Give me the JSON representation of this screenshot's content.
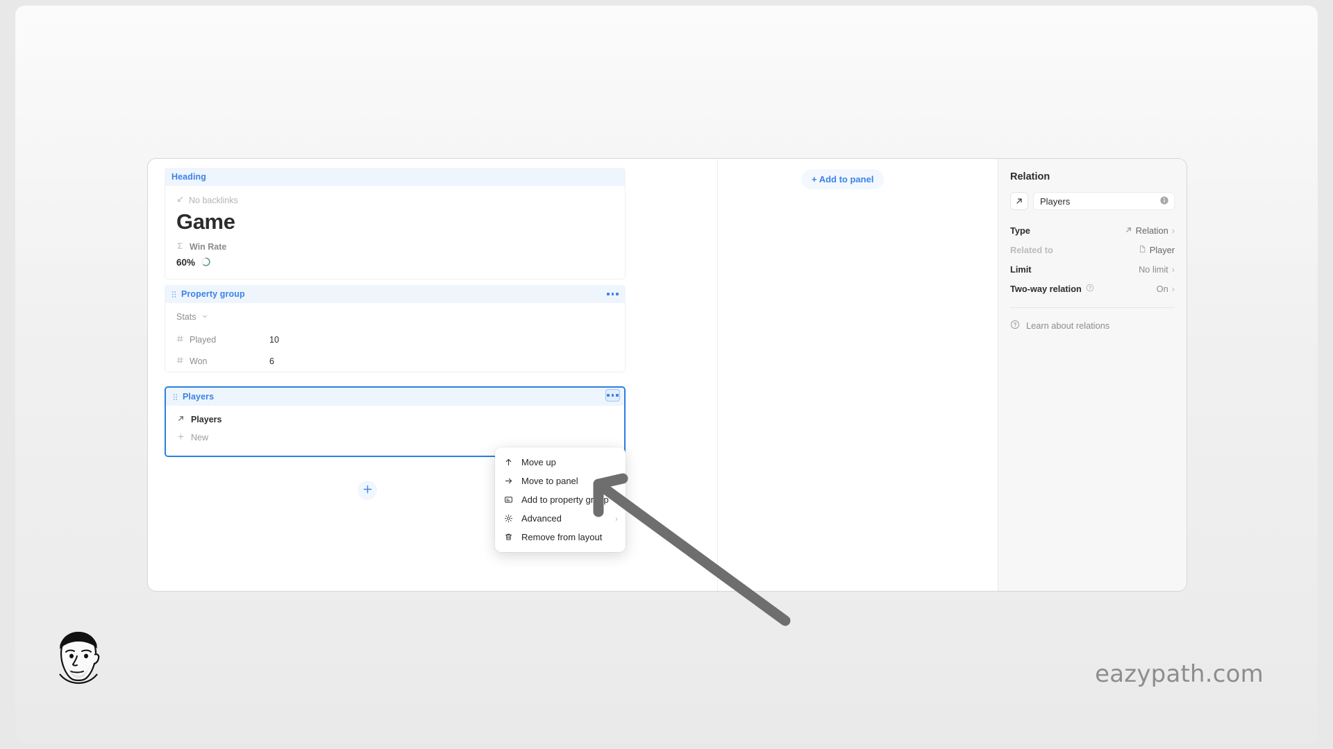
{
  "blocks": {
    "heading": {
      "label": "Heading",
      "backlinks": "No backlinks",
      "backlinks_icon": "arrow-down-left-icon",
      "title": "Game",
      "winrate_label": "Win Rate",
      "winrate_icon": "sigma-icon",
      "winrate_value": "60%",
      "winrate_percent": 60,
      "winrate_color": "#5e9e85"
    },
    "property_group": {
      "label": "Property group",
      "drag_icon": "drag-handle-icon",
      "more_icon": "ellipsis-icon",
      "section": "Stats",
      "section_chevron": "chevron-down-icon",
      "rows": [
        {
          "icon": "hash-icon",
          "key": "Played",
          "value": "10"
        },
        {
          "icon": "hash-icon",
          "key": "Won",
          "value": "6"
        }
      ]
    },
    "players": {
      "label": "Players",
      "drag_icon": "drag-handle-icon",
      "more_icon": "ellipsis-icon",
      "relation_icon": "arrow-up-right-icon",
      "relation_name": "Players",
      "new_icon": "plus-icon",
      "new_label": "New",
      "selected_color": "#2a7ee0"
    },
    "add_block_button": {
      "icon": "plus-icon",
      "label": "+"
    }
  },
  "panel": {
    "add_to_panel_label": "+ Add to panel",
    "accent": "#3b82e8"
  },
  "context_menu": {
    "items": [
      {
        "icon": "arrow-up-icon",
        "label": "Move up",
        "submenu": false
      },
      {
        "icon": "arrow-right-icon",
        "label": "Move to panel",
        "submenu": false
      },
      {
        "icon": "card-icon",
        "label": "Add to property group",
        "submenu": false
      },
      {
        "icon": "gear-icon",
        "label": "Advanced",
        "submenu": true
      },
      {
        "icon": "trash-icon",
        "label": "Remove from layout",
        "submenu": false
      }
    ],
    "submenu_chevron": "›"
  },
  "sidebar": {
    "title": "Relation",
    "name_icon": "arrow-up-right-icon",
    "name_value": "Players",
    "info_icon": "info-icon",
    "rows": [
      {
        "label": "Type",
        "value": "Relation",
        "value_icon": "arrow-up-right-icon",
        "chevron": "›",
        "dim_label": false
      },
      {
        "label": "Related to",
        "value": "Player",
        "value_icon": "document-icon",
        "chevron": "",
        "dim_label": true
      },
      {
        "label": "Limit",
        "value": "No limit",
        "value_icon": "",
        "chevron": "›",
        "dim_label": false
      },
      {
        "label": "Two-way relation",
        "value": "On",
        "value_icon": "",
        "chevron": "›",
        "dim_label": false,
        "help_icon": "question-circle-icon"
      }
    ],
    "learn_icon": "question-circle-icon",
    "learn_label": "Learn about relations"
  },
  "footer": {
    "avatar_icon": "avatar-illustration",
    "watermark": "eazypath.com"
  }
}
